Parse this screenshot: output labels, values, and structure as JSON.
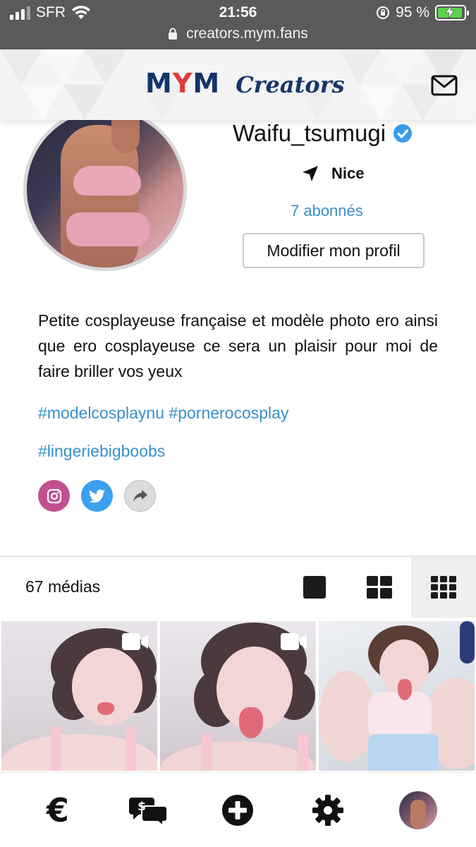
{
  "status_bar": {
    "carrier": "SFR",
    "time": "21:56",
    "battery_percent": "95 %",
    "url": "creators.mym.fans",
    "battery_level": 0.95
  },
  "header": {
    "logo_mym": "MYM",
    "logo_creators": "Creators",
    "mail_icon": "mail-icon"
  },
  "profile": {
    "username": "Waifu_tsumugi",
    "location": "Nice",
    "followers": "7 abonnés",
    "edit_button": "Modifier mon profil",
    "bio": "Petite cosplayeuse française et modèle photo ero ainsi que ero cosplayeuse ce sera un plaisir pour moi de faire briller vos yeux",
    "hashtags": [
      "#modelcosplaynu",
      "#pornerocosplay",
      "#lingeriebigboobs"
    ],
    "socials": [
      {
        "name": "instagram",
        "icon": "instagram-icon",
        "color": "#c0508e"
      },
      {
        "name": "twitter",
        "icon": "twitter-icon",
        "color": "#3ba0ee"
      },
      {
        "name": "share",
        "icon": "share-icon",
        "color": "#dcdcdc"
      }
    ]
  },
  "media": {
    "count_label": "67 médias",
    "view_modes": [
      "single-view",
      "grid-2x2-view",
      "grid-3x3-view"
    ],
    "active_view": "grid-3x3-view",
    "items": [
      {
        "type": "video",
        "icon": "video-camera-icon"
      },
      {
        "type": "video",
        "icon": "video-camera-icon"
      },
      {
        "type": "photo"
      }
    ]
  },
  "bottom_nav": {
    "items": [
      "euro-icon",
      "chat-money-icon",
      "add-icon",
      "settings-icon",
      "profile-avatar"
    ]
  },
  "colors": {
    "brand_navy": "#14356a",
    "brand_red": "#e33b3b",
    "link_blue": "#3a8fc8",
    "verified_blue": "#3a9be8"
  }
}
